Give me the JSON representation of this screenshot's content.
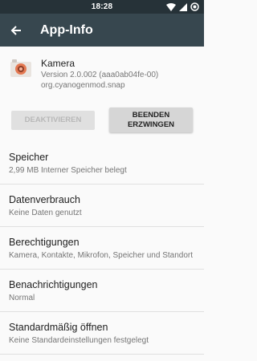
{
  "status": {
    "time": "18:28"
  },
  "toolbar": {
    "title": "App-Info"
  },
  "app": {
    "name": "Kamera",
    "version": "Version 2.0.002 (aaa0ab04fe-00)",
    "package": "org.cyanogenmod.snap"
  },
  "buttons": {
    "disable": "DEAKTIVIEREN",
    "force_stop_line1": "BEENDEN",
    "force_stop_line2": "ERZWINGEN"
  },
  "items": [
    {
      "title": "Speicher",
      "subtitle": "2,99 MB Interner Speicher belegt"
    },
    {
      "title": "Datenverbrauch",
      "subtitle": "Keine Daten genutzt"
    },
    {
      "title": "Berechtigungen",
      "subtitle": "Kamera, Kontakte, Mikrofon, Speicher und Standort"
    },
    {
      "title": "Benachrichtigungen",
      "subtitle": "Normal"
    },
    {
      "title": "Standardmäßig öffnen",
      "subtitle": "Keine Standardeinstellungen festgelegt"
    }
  ],
  "colors": {
    "statusbar": "#263238",
    "toolbar": "#37474f",
    "accent": "#e57a53"
  }
}
